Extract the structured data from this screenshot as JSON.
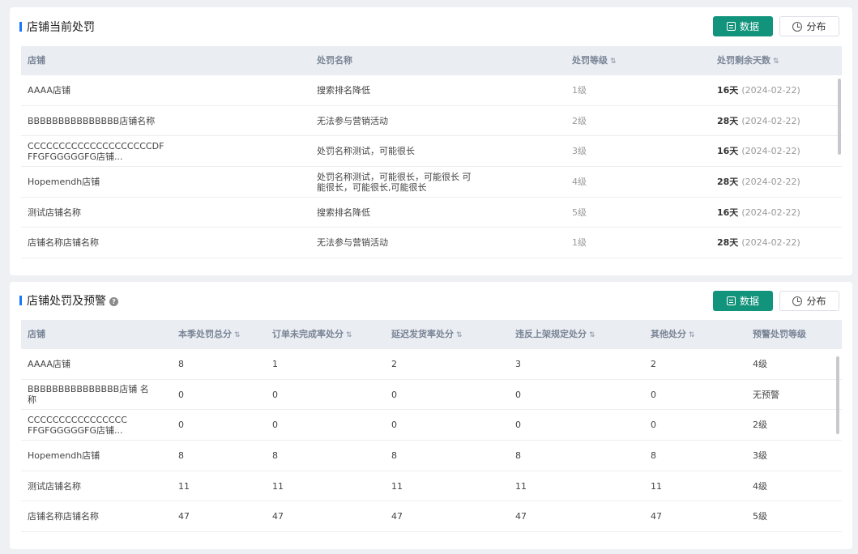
{
  "panel1": {
    "title": "店铺当前处罚",
    "btn_data": "数据",
    "btn_dist": "分布",
    "columns": [
      "店铺",
      "处罚名称",
      "处罚等级",
      "处罚剩余天数"
    ],
    "rows": [
      {
        "shop": "AAAA店铺",
        "name": "搜索排名降低",
        "level": "1级",
        "days": "16天",
        "date": "(2024-02-22)"
      },
      {
        "shop": "BBBBBBBBBBBBBBB店铺名称",
        "name": "无法参与营销活动",
        "level": "2级",
        "days": "28天",
        "date": "(2024-02-22)"
      },
      {
        "shop": "CCCCCCCCCCCCCCCCCCCCDF FFGFGGGGGFG店铺...",
        "name": "处罚名称测试，可能很长",
        "level": "3级",
        "days": "16天",
        "date": "(2024-02-22)"
      },
      {
        "shop": "Hopemendh店铺",
        "name": "处罚名称测试，可能很长，可能很长 可能很长，可能很长,可能很长",
        "level": "4级",
        "days": "28天",
        "date": "(2024-02-22)"
      },
      {
        "shop": "测试店铺名称",
        "name": "搜索排名降低",
        "level": "5级",
        "days": "16天",
        "date": "(2024-02-22)"
      },
      {
        "shop": "店铺名称店铺名称",
        "name": "无法参与营销活动",
        "level": "1级",
        "days": "28天",
        "date": "(2024-02-22)"
      }
    ]
  },
  "panel2": {
    "title": "店铺处罚及预警",
    "btn_data": "数据",
    "btn_dist": "分布",
    "columns": [
      "店铺",
      "本季处罚总分",
      "订单未完成率处分",
      "延迟发货率处分",
      "违反上架规定处分",
      "其他处分",
      "预警处罚等级"
    ],
    "rows": [
      {
        "shop": "AAAA店铺",
        "v1": "8",
        "v2": "1",
        "v3": "2",
        "v4": "3",
        "v5": "2",
        "warn": "4级"
      },
      {
        "shop": "BBBBBBBBBBBBBBB店铺 名称",
        "v1": "0",
        "v2": "0",
        "v3": "0",
        "v4": "0",
        "v5": "0",
        "warn": "无预警"
      },
      {
        "shop": "CCCCCCCCCCCCCCCC FFGFGGGGGFG店铺...",
        "v1": "0",
        "v2": "0",
        "v3": "0",
        "v4": "0",
        "v5": "0",
        "warn": "2级"
      },
      {
        "shop": "Hopemendh店铺",
        "v1": "8",
        "v2": "8",
        "v3": "8",
        "v4": "8",
        "v5": "8",
        "warn": "3级"
      },
      {
        "shop": "测试店铺名称",
        "v1": "11",
        "v2": "11",
        "v3": "11",
        "v4": "11",
        "v5": "11",
        "warn": "4级"
      },
      {
        "shop": "店铺名称店铺名称",
        "v1": "47",
        "v2": "47",
        "v3": "47",
        "v4": "47",
        "v5": "47",
        "warn": "5级"
      }
    ]
  }
}
